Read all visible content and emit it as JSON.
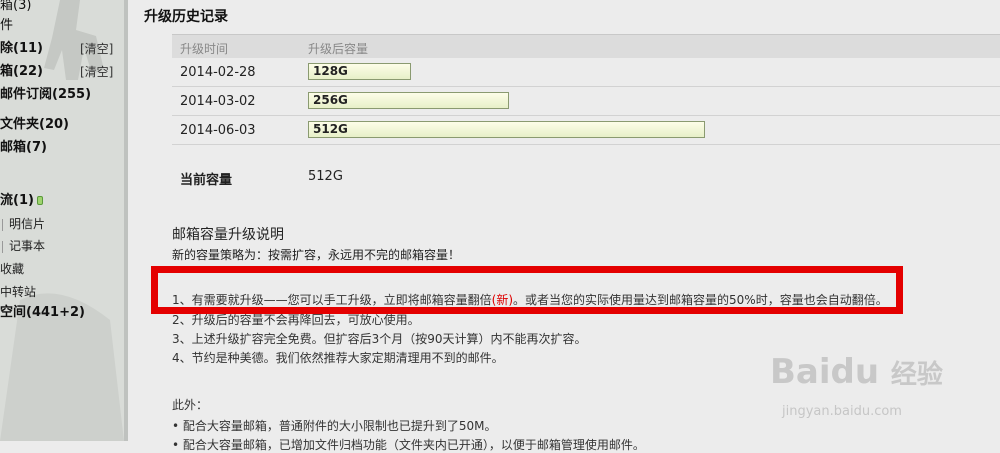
{
  "sidebar": {
    "items": [
      {
        "label": "箱(3)",
        "clear": ""
      },
      {
        "label": "件",
        "clear": ""
      },
      {
        "label": "除(11)",
        "clear": "[清空]"
      },
      {
        "label": "箱(22)",
        "clear": "[清空]"
      },
      {
        "label": "邮件订阅(255)",
        "clear": ""
      },
      {
        "label": "文件夹(20)",
        "clear": ""
      },
      {
        "label": "邮箱(7)",
        "clear": ""
      },
      {
        "label": "流(1)",
        "clear": ""
      }
    ],
    "sub_items": [
      "明信片",
      "记事本"
    ],
    "bottom_items": [
      "收藏",
      "中转站",
      "空间(441+2)"
    ]
  },
  "history": {
    "title": "升级历史记录",
    "col_time": "升级时间",
    "col_cap": "升级后容量",
    "rows": [
      {
        "date": "2014-02-28",
        "cap": "128G"
      },
      {
        "date": "2014-03-02",
        "cap": "256G"
      },
      {
        "date": "2014-06-03",
        "cap": "512G"
      }
    ],
    "current_label": "当前容量",
    "current_value": "512G"
  },
  "explain": {
    "title": "邮箱容量升级说明",
    "subtitle": "新的容量策略为：按需扩容，永远用不完的邮箱容量！",
    "item1_a": "1、有需要就升级——您可以手工升级，立即将邮箱容量翻倍",
    "item1_new": "(新)",
    "item1_b": "。或者当您的实际使用量达到邮箱容量的50%时，容量也会自动翻倍。",
    "item2": "2、升级后的容量不会再降回去，可放心使用。",
    "item3": "3、上述升级扩容完全免费。但扩容后3个月（按90天计算）内不能再次扩容。",
    "item4": "4、节约是种美德。我们依然推荐大家定期清理用不到的邮件。",
    "besides": "此外：",
    "bullet1": "• 配合大容量邮箱，普通附件的大小限制也已提升到了50M。",
    "bullet2": "• 配合大容量邮箱，已增加文件归档功能（文件夹内已开通），以便于邮箱管理使用邮件。"
  },
  "watermark": {
    "brand": "Baidu",
    "brand_cn": "经验",
    "url": "jingyan.baidu.com"
  },
  "colors": {
    "highlight": "#e40000"
  }
}
